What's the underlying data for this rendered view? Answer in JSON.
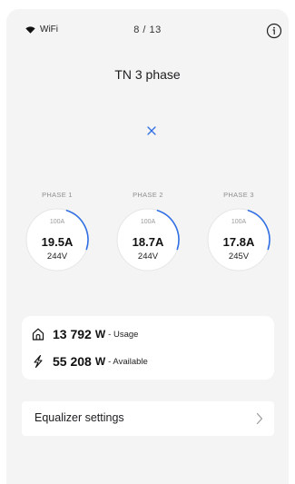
{
  "status": {
    "wifi_label": "WiFi",
    "step": "8 / 13"
  },
  "header": {
    "title": "TN 3 phase"
  },
  "colors": {
    "accent": "#2f6fe4",
    "gauge_track": "#e6e6e6",
    "background": "#f4f4f4",
    "card": "#ffffff"
  },
  "phases": [
    {
      "label": "PHASE 1",
      "max": "100A",
      "current": "19.5A",
      "voltage": "244V"
    },
    {
      "label": "PHASE 2",
      "max": "100A",
      "current": "18.7A",
      "voltage": "244V"
    },
    {
      "label": "PHASE 3",
      "max": "100A",
      "current": "17.8A",
      "voltage": "245V"
    }
  ],
  "power": {
    "usage": {
      "value": "13 792",
      "unit": "W",
      "label": "- Usage",
      "icon": "home-icon"
    },
    "available": {
      "value": "55 208",
      "unit": "W",
      "label": "- Available",
      "icon": "bolt-icon"
    }
  },
  "equalizer": {
    "label": "Equalizer settings"
  },
  "icons": {
    "wifi": "wifi-icon",
    "info": "info-icon",
    "close": "close-icon",
    "chevron": "chevron-right-icon"
  }
}
